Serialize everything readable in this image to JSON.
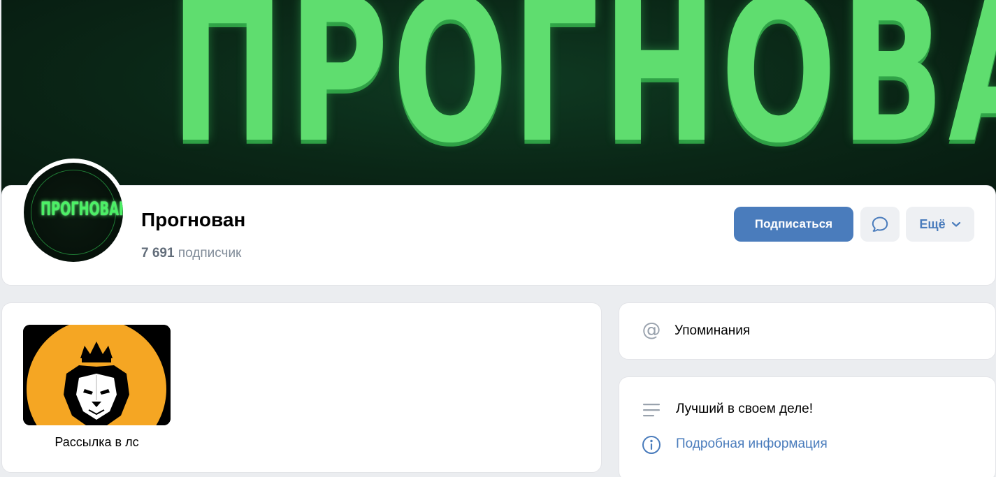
{
  "cover": {
    "title": "ПРОГНОВАН",
    "text_color": "#5fdd6f",
    "background": "#0a2616"
  },
  "avatar": {
    "text": "ПРОГНОВАН",
    "text_color": "#4cf066"
  },
  "group": {
    "name": "Прогнован",
    "subscribers_count": "7 691",
    "subscribers_label": "подписчик"
  },
  "actions": {
    "subscribe_label": "Подписаться",
    "message_icon": "chat-bubble-icon",
    "more_label": "Ещё",
    "more_icon": "chevron-down-icon",
    "accent_color": "#4a7cbc"
  },
  "links": [
    {
      "caption": "Рассылка в лс",
      "image": "lion-crown-logo",
      "image_bg": "#f5a623"
    }
  ],
  "sidebar": {
    "mentions_icon": "at-icon",
    "mentions_label": "Упоминания",
    "status_icon": "lines-icon",
    "status_text": "Лучший в своем деле!",
    "info_icon": "info-icon",
    "info_link": "Подробная информация"
  }
}
